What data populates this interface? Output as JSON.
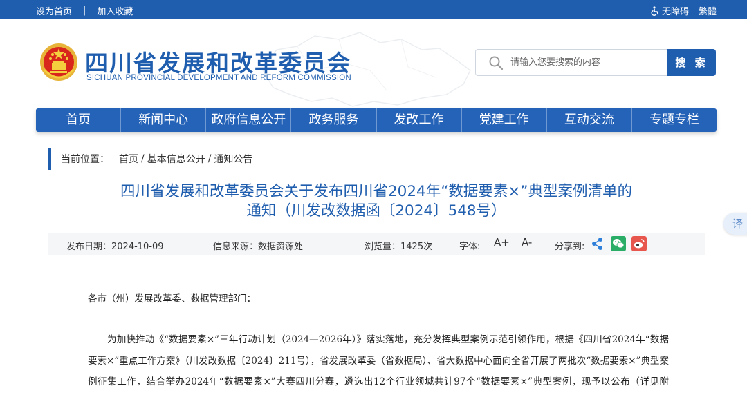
{
  "topbar": {
    "set_home": "设为首页",
    "separator": "|",
    "add_favorite": "加入收藏",
    "accessibility": "无障碍",
    "traditional": "繁體"
  },
  "header": {
    "title": "四川省发展和改革委员会",
    "subtitle": "SICHUAN PROVINCIAL DEVELOPMENT AND REFORM COMMISSION",
    "emblem_icon": "national-emblem-icon"
  },
  "search": {
    "placeholder": "请输入您要搜索的内容",
    "button_label": "搜 索"
  },
  "nav": {
    "items": [
      {
        "label": "首页"
      },
      {
        "label": "新闻中心"
      },
      {
        "label": "政府信息公开"
      },
      {
        "label": "政务服务"
      },
      {
        "label": "发改工作"
      },
      {
        "label": "党建工作"
      },
      {
        "label": "互动交流"
      },
      {
        "label": "专题专栏"
      }
    ]
  },
  "breadcrumb": {
    "label": "当前位置：",
    "items": [
      "首页",
      "基本信息公开",
      "通知公告"
    ],
    "separator": "/"
  },
  "article": {
    "title_line1": "四川省发展和改革委员会关于发布四川省2024年“数据要素×”典型案例清单的",
    "title_line2": "通知（川发改数据函〔2024〕548号）",
    "meta": {
      "date_label": "发布日期：",
      "date": "2024-10-09",
      "source_label": "信息来源：",
      "source": "数据资源处",
      "views_label": "浏览量：",
      "views": "1425次",
      "font_label": "字体:",
      "font_increase": "A+",
      "font_decrease": "A-",
      "share_label": "分享到:"
    },
    "salutation": "各市（州）发展改革委、数据管理部门：",
    "paragraph": "为加快推动《“数据要素×”三年行动计划（2024—2026年）》落实落地，充分发挥典型案例示范引领作用，根据《四川省2024年“数据要素×”重点工作方案》（川发改数据〔2024〕211号），省发展改革委（省数据局）、省大数据中心面向全省开展了两批次“数据要素×”典型案例征集工作，结合举办2024年“数据要素×”大赛四川分赛，遴选出12个行业领域共计97个“数据要素×”典型案例，现予以公布（详见附件）。"
  },
  "translate_label": "译",
  "colors": {
    "primary": "#1f5dae",
    "nav": "#2563b8",
    "wechat": "#2aae67",
    "weibo": "#e8574d"
  }
}
